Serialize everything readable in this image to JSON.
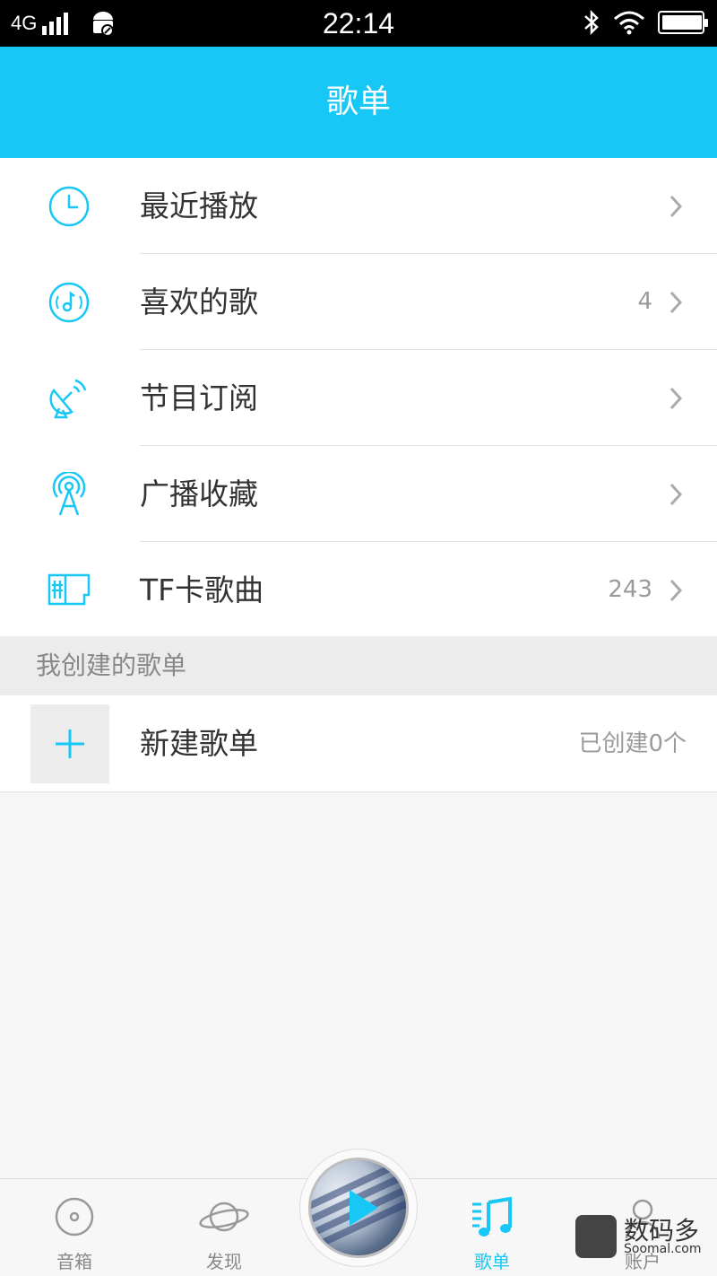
{
  "status_bar": {
    "network": "4G",
    "time": "22:14"
  },
  "header": {
    "title": "歌单"
  },
  "menu": {
    "items": [
      {
        "label": "最近播放",
        "count": "",
        "icon": "clock-icon"
      },
      {
        "label": "喜欢的歌",
        "count": "4",
        "icon": "music-disc-icon"
      },
      {
        "label": "节目订阅",
        "count": "",
        "icon": "satellite-dish-icon"
      },
      {
        "label": "广播收藏",
        "count": "",
        "icon": "radio-tower-icon"
      },
      {
        "label": "TF卡歌曲",
        "count": "243",
        "icon": "sd-card-icon"
      }
    ]
  },
  "created_section": {
    "title": "我创建的歌单",
    "new_label": "新建歌单",
    "count_text": "已创建0个"
  },
  "bottom_nav": {
    "tabs": [
      {
        "label": "音箱",
        "icon": "speaker-icon"
      },
      {
        "label": "发现",
        "icon": "planet-icon"
      },
      {
        "label": "歌单",
        "icon": "playlist-icon",
        "active": true
      },
      {
        "label": "账户",
        "icon": "user-icon"
      }
    ]
  },
  "watermark": {
    "title": "数码多",
    "subtitle": "Soomal.com"
  },
  "colors": {
    "accent": "#17c7f5",
    "text": "#333333",
    "muted": "#9a9a9a"
  }
}
